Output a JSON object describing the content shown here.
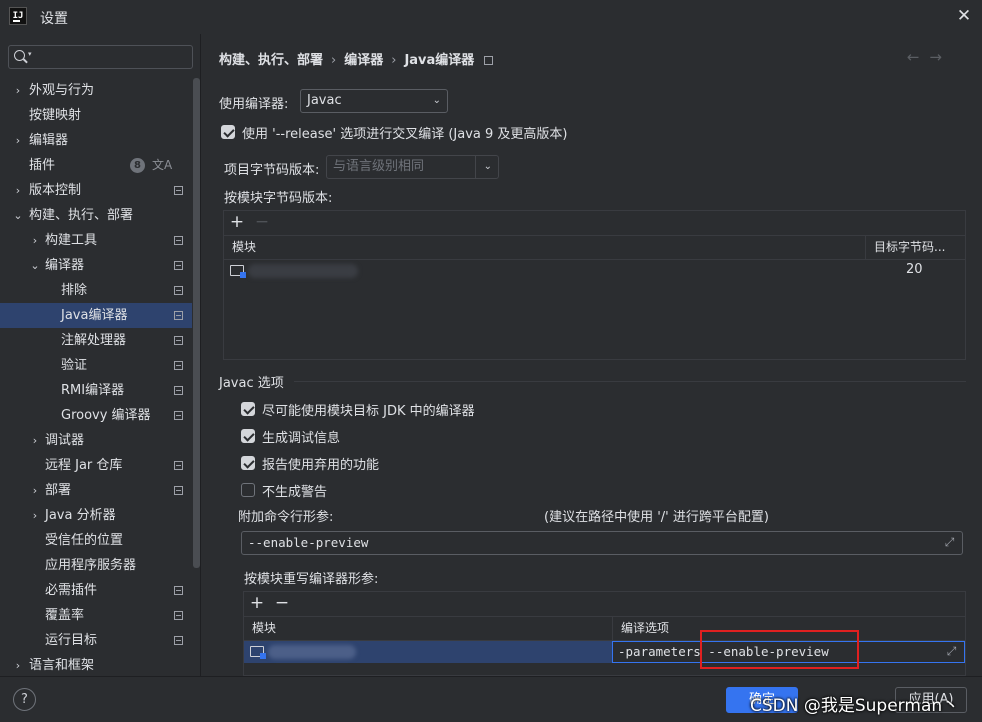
{
  "window": {
    "title": "设置"
  },
  "search": {
    "placeholder": ""
  },
  "sidebar": {
    "items": [
      {
        "label": "外观与行为"
      },
      {
        "label": "按键映射"
      },
      {
        "label": "编辑器"
      },
      {
        "label": "插件",
        "badge": "8"
      },
      {
        "label": "版本控制"
      },
      {
        "label": "构建、执行、部署"
      },
      {
        "label": "构建工具"
      },
      {
        "label": "编译器"
      },
      {
        "label": "排除"
      },
      {
        "label": "Java编译器"
      },
      {
        "label": "注解处理器"
      },
      {
        "label": "验证"
      },
      {
        "label": "RMI编译器"
      },
      {
        "label": "Groovy 编译器"
      },
      {
        "label": "调试器"
      },
      {
        "label": "远程 Jar 仓库"
      },
      {
        "label": "部署"
      },
      {
        "label": "Java 分析器"
      },
      {
        "label": "受信任的位置"
      },
      {
        "label": "应用程序服务器"
      },
      {
        "label": "必需插件"
      },
      {
        "label": "覆盖率"
      },
      {
        "label": "运行目标"
      },
      {
        "label": "语言和框架"
      }
    ]
  },
  "breadcrumb": {
    "part1": "构建、执行、部署",
    "sep": "›",
    "part2": "编译器",
    "part3": "Java编译器"
  },
  "compiler": {
    "use_compiler_label": "使用编译器:",
    "use_compiler_value": "Javac",
    "release_option_label": "使用 '--release' 选项进行交叉编译 (Java 9 及更高版本)",
    "release_option_checked": true,
    "bytecode_label": "项目字节码版本:",
    "bytecode_value": "与语言级别相同",
    "per_module_bytecode_label": "按模块字节码版本:"
  },
  "module_table": {
    "col_module": "模块",
    "col_target": "目标字节码...",
    "rows": [
      {
        "target": "20"
      }
    ]
  },
  "javac": {
    "section_title": "Javac 选项",
    "options": [
      {
        "label": "尽可能使用模块目标 JDK 中的编译器",
        "checked": true
      },
      {
        "label": "生成调试信息",
        "checked": true
      },
      {
        "label": "报告使用弃用的功能",
        "checked": true
      },
      {
        "label": "不生成警告",
        "checked": false
      }
    ],
    "extra_params_label": "附加命令行形参:",
    "extra_params_hint": "(建议在路径中使用 '/' 进行跨平台配置)",
    "extra_params_value": "--enable-preview",
    "override_label": "按模块重写编译器形参:",
    "override_table": {
      "col_module": "模块",
      "col_options": "编译选项",
      "rows": [
        {
          "options": "-parameters --enable-preview"
        }
      ]
    }
  },
  "bottom": {
    "help": "?",
    "ok": "确定",
    "apply": "应用(A)"
  },
  "watermark": "CSDN @我是Superman丶",
  "icons": {
    "title": "intellij-logo-icon",
    "close": "close-icon",
    "search": "search-icon",
    "page": "settings-page-icon",
    "module": "module-folder-icon",
    "expand": "expand-icon"
  },
  "colors": {
    "selection": "#2e436e",
    "accent": "#3574f0",
    "highlight_box": "#e02020",
    "background": "#2b2d30"
  }
}
